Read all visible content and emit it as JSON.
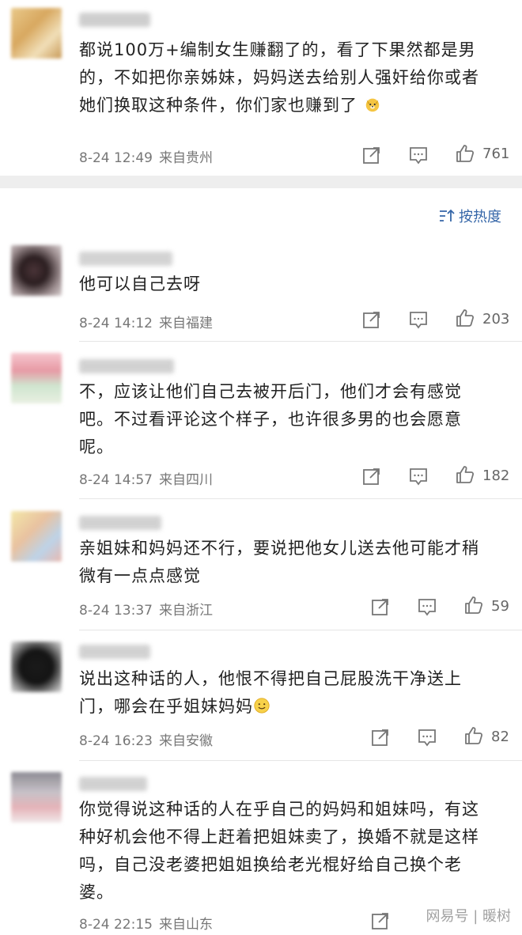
{
  "comments": [
    {
      "lines": [
        "都说100万+编制女生赚翻了的，看了下果然都是男",
        "的，不如把你亲姊妹，妈妈送去给别人强奸给你或者",
        "她们换取这种条件，你们家也赚到了"
      ],
      "emoji": "dog-face",
      "date": "8-24 12:49",
      "location": "来自贵州",
      "likes": "761"
    },
    {
      "lines": [
        "他可以自己去呀"
      ],
      "date": "8-24 14:12",
      "location": "来自福建",
      "likes": "203"
    },
    {
      "lines": [
        "不，应该让他们自己去被开后门，他们才会有感觉",
        "吧。不过看评论这个样子，也许很多男的也会愿意",
        "呢。"
      ],
      "date": "8-24 14:57",
      "location": "来自四川",
      "likes": "182"
    },
    {
      "lines": [
        "亲姐妹和妈妈还不行，要说把他女儿送去他可能才稍",
        "微有一点点感觉"
      ],
      "date": "8-24 13:37",
      "location": "来自浙江",
      "likes": "59"
    },
    {
      "lines": [
        "说出这种话的人，他恨不得把自己屁股洗干净送上",
        "门，哪会在乎姐妹妈妈"
      ],
      "emoji": "smile-face",
      "date": "8-24 16:23",
      "location": "来自安徽",
      "likes": "82"
    },
    {
      "lines": [
        "你觉得说这种话的人在乎自己的妈妈和姐妹吗，有这",
        "种好机会他不得上赶着把姐妹卖了，换婚不就是这样",
        "吗，自己没老婆把姐姐换给老光棍好给自己换个老",
        "婆。"
      ],
      "date": "8-24 22:15",
      "location": "来自山东",
      "likes": ""
    }
  ],
  "sort_label": "按热度",
  "watermark": "网易号 | 暖树",
  "colors": {
    "accent": "#3566a8",
    "meta": "#777777",
    "band": "#eeeeee"
  }
}
